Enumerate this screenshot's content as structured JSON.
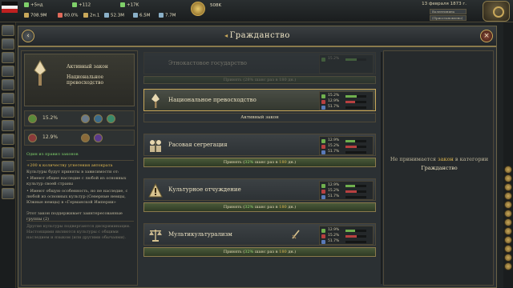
{
  "topbar": {
    "resources": [
      {
        "text": "+5нд",
        "cls": "green"
      },
      {
        "text": "+112",
        "cls": "green"
      },
      {
        "text": "+17K",
        "cls": "green"
      },
      {
        "text": "708.9M"
      },
      {
        "text": "80.0%"
      },
      {
        "text": "2н.1"
      },
      {
        "text": "52.3M"
      },
      {
        "text": "6.5M"
      },
      {
        "text": "7.7M"
      },
      {
        "text": "508K"
      }
    ],
    "date": "13 февраля 1873 г.",
    "speed1": "Валентинина Форте",
    "speed2": "(Приостановлено)",
    "colors": {
      "accent": "#c9a85a",
      "positive": "#7fd06a",
      "negative": "#e06a5a"
    }
  },
  "window": {
    "title": "Гражданство",
    "close_glyph": "×",
    "back_glyph": "‹"
  },
  "left_panel": {
    "law_kind": "Активный закон",
    "law_name": "Национальное превосходство",
    "support1": "15.2%",
    "support2": "12.9%",
    "note": "Один из правил законов",
    "effect_head": "+200 к количеству угнетения автократа",
    "effect_line1": "Культуры будут приняты в зависимости от:",
    "effect_b1": "• Имеют общее наследие с любой из основных культур своей страны",
    "effect_b2": "• Имеют общую особенность, но не наследие, с любой из основных культур (Северные немцы, Южные немцы) в «Германской Империи»",
    "effect_support": "Этот закон поддерживает заинтересованные группы (2)",
    "effect_footer": "Другие культуры подвергаются дискриминации. Настоящими являются культуры с общими наследием и языком (или другими обычаями)."
  },
  "laws": [
    {
      "name": "Этнокастовое государство",
      "faded": true,
      "stats": [
        {
          "val": "15.2%",
          "color": "#6fb04e",
          "fill": 0.55
        },
        {
          "val": "",
          "color": "#8a3030",
          "fill": 0
        }
      ],
      "action": "Принять (28% шанс раз в 180 дн.)"
    },
    {
      "name": "Национальное превосходство",
      "selected": true,
      "stats": [
        {
          "val": "15.2%",
          "color": "#6fb04e",
          "fill": 0.55
        },
        {
          "val": "12.9%",
          "color": "#b84040",
          "fill": 0.45
        },
        {
          "val": "51.7%",
          "color": "#5a7ab8",
          "fill": 0.0
        }
      ],
      "action": "Активный закон"
    },
    {
      "name": "Расовая сегрегация",
      "stats": [
        {
          "val": "12.9%",
          "color": "#6fb04e",
          "fill": 0.45
        },
        {
          "val": "15.2%",
          "color": "#b84040",
          "fill": 0.55
        },
        {
          "val": "51.7%",
          "color": "#5a7ab8",
          "fill": 0.0
        }
      ],
      "action_pre": "Принять (",
      "action_pct": "32%",
      "action_mid": " шанс раз в ",
      "action_days": "180",
      "action_post": " дн.)"
    },
    {
      "name": "Культурное отчуждение",
      "stats": [
        {
          "val": "12.9%",
          "color": "#6fb04e",
          "fill": 0.45
        },
        {
          "val": "15.2%",
          "color": "#b84040",
          "fill": 0.55
        },
        {
          "val": "51.7%",
          "color": "#5a7ab8",
          "fill": 0.0
        }
      ],
      "action_pre": "Принять (",
      "action_pct": "32%",
      "action_mid": " шанс раз в ",
      "action_days": "180",
      "action_post": " дн.)"
    },
    {
      "name": "Мультикультурализм",
      "stats": [
        {
          "val": "12.9%",
          "color": "#6fb04e",
          "fill": 0.45
        },
        {
          "val": "15.2%",
          "color": "#b84040",
          "fill": 0.55
        },
        {
          "val": "51.7%",
          "color": "#5a7ab8",
          "fill": 0.0
        }
      ],
      "action_pre": "Принять (",
      "action_pct": "32%",
      "action_mid": " шанс раз в ",
      "action_days": "180",
      "action_post": " дн.)"
    }
  ],
  "right_panel": {
    "pre": "Не принимается ",
    "word": "закон",
    "mid": " в категории",
    "category": "Гражданство"
  }
}
